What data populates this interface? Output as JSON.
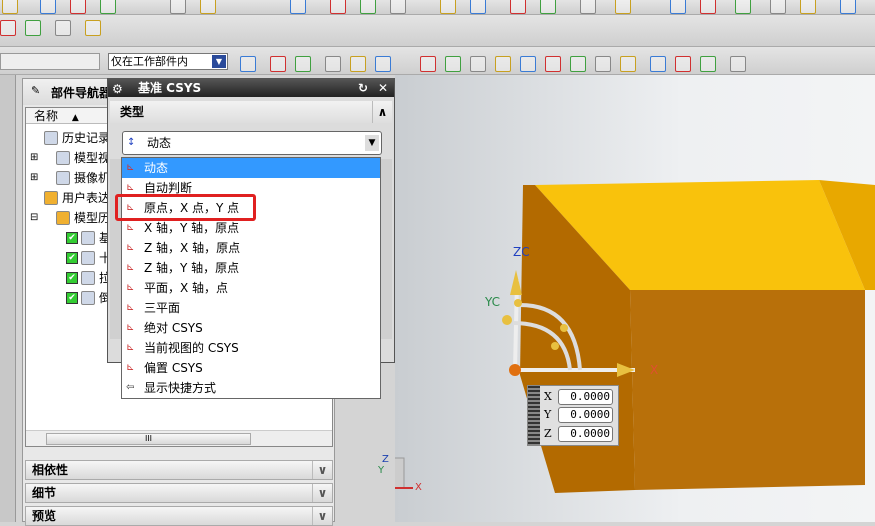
{
  "toolbar": {
    "filter_value": "仅在工作部件内"
  },
  "navigator": {
    "title": "部件导航器",
    "column_name": "名称",
    "sort_icon": "triangle-up",
    "items": [
      {
        "label": "历史记录",
        "icon": "clock-icon",
        "indent": 1
      },
      {
        "label": "模型视图",
        "icon": "view-icon",
        "indent": 0,
        "expand": "+"
      },
      {
        "label": "摄像机",
        "icon": "camera-icon",
        "indent": 0,
        "expand": "+"
      },
      {
        "label": "用户表达式",
        "icon": "folder-icon",
        "indent": 1
      },
      {
        "label": "模型历史记录",
        "icon": "folder-icon",
        "indent": 0,
        "expand": "-"
      },
      {
        "label": "基准坐标系",
        "icon": "csys-icon",
        "indent": 2
      },
      {
        "label": "十点",
        "icon": "point-icon",
        "indent": 2
      },
      {
        "label": "拉伸",
        "icon": "extrude-icon",
        "indent": 2
      },
      {
        "label": "倒斜角",
        "icon": "chamfer-icon",
        "indent": 2
      }
    ],
    "sections": [
      "相依性",
      "细节",
      "预览"
    ],
    "scroll_label": "III"
  },
  "dialog": {
    "title": "基准 CSYS",
    "section": "类型",
    "selected": "动态",
    "options": [
      "动态",
      "自动判断",
      "原点，X 点，Y 点",
      "X 轴，Y 轴，原点",
      "Z 轴，X 轴，原点",
      "Z 轴，Y 轴，原点",
      "平面，X 轴，点",
      "三平面",
      "绝对 CSYS",
      "当前视图的 CSYS",
      "偏置 CSYS",
      "显示快捷方式"
    ],
    "highlighted_index": 2
  },
  "viewport": {
    "coords": {
      "x_label": "X",
      "y_label": "Y",
      "z_label": "Z",
      "x": "0.0000",
      "y": "0.0000",
      "z": "0.0000"
    },
    "handle_labels": {
      "zc": "ZC",
      "yc": "YC",
      "x": "X"
    },
    "triad": {
      "z": "Z",
      "y": "Y",
      "x": "X"
    }
  },
  "colors": {
    "highlight_box": "#e02020",
    "arrow": "#e03020",
    "part": "#f5b800",
    "selection": "#3399ff"
  }
}
